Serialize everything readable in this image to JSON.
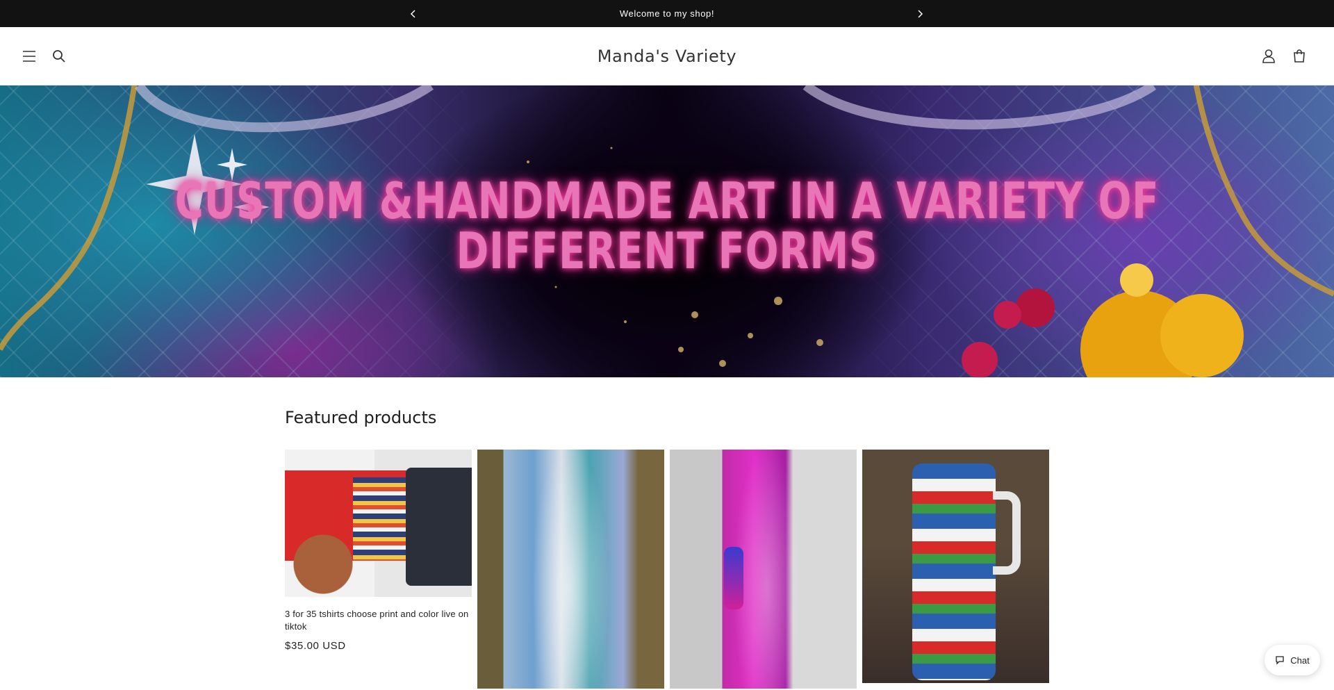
{
  "announcement": {
    "text": "Welcome to my shop!"
  },
  "header": {
    "logo": "Manda's Variety",
    "icons": [
      "menu-icon",
      "search-icon",
      "account-icon",
      "cart-icon"
    ]
  },
  "banner": {
    "headline_line1": "CUSTOM &HANDMADE ART IN A VARIETY OF",
    "headline_line2": "DIFFERENT FORMS"
  },
  "featured": {
    "heading": "Featured products",
    "products": [
      {
        "title": "3 for 35 tshirts choose print and color live on tiktok",
        "price": "$35.00 USD"
      },
      {
        "title": "",
        "price": ""
      },
      {
        "title": "",
        "price": ""
      },
      {
        "title": "",
        "price": ""
      }
    ]
  },
  "chat": {
    "label": "Chat"
  },
  "colors": {
    "announcement_bg": "#121212",
    "headline_glow": "#e875b6"
  }
}
